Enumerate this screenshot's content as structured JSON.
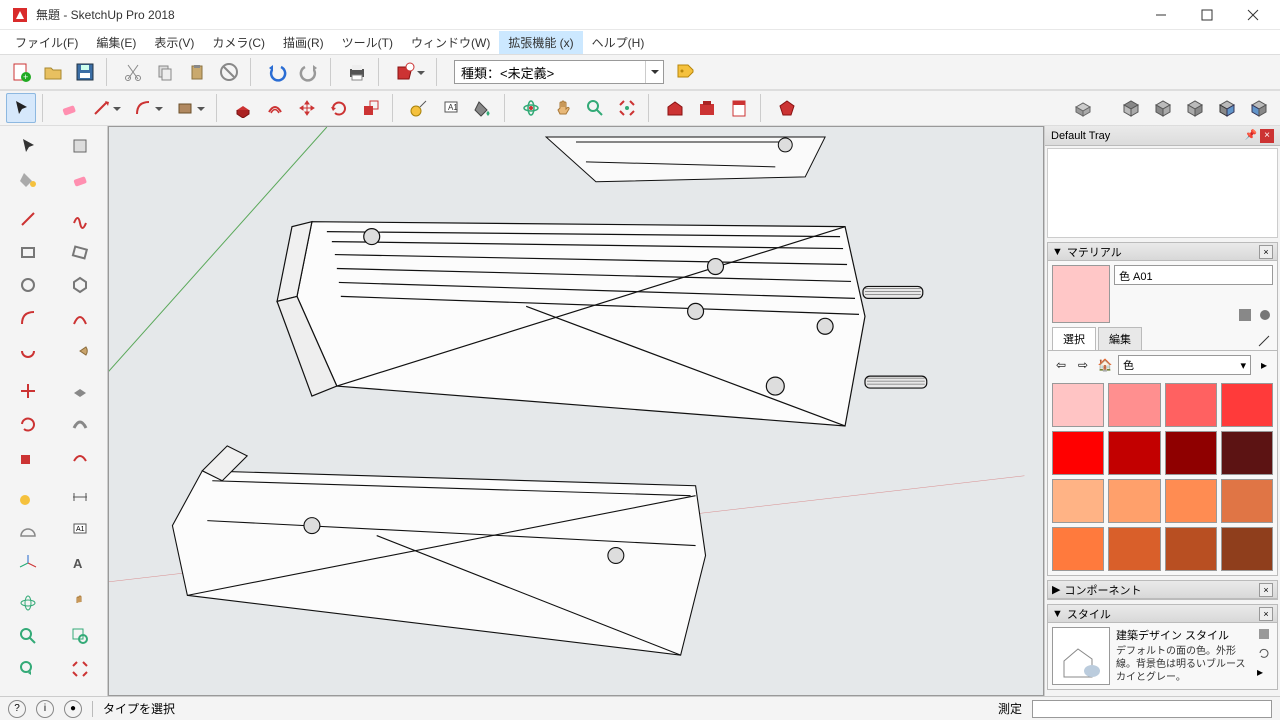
{
  "window": {
    "title": "無題 - SketchUp Pro 2018"
  },
  "menus": [
    "ファイル(F)",
    "編集(E)",
    "表示(V)",
    "カメラ(C)",
    "描画(R)",
    "ツール(T)",
    "ウィンドウ(W)",
    "拡張機能 (x)",
    "ヘルプ(H)"
  ],
  "menus_hover_index": 7,
  "category_label": "種類：<未定義>",
  "tray": {
    "title": "Default Tray"
  },
  "material_panel": {
    "title": "マテリアル",
    "name": "色 A01",
    "tab_select": "選択",
    "tab_edit": "編集",
    "category": "色"
  },
  "swatches": [
    "#ffc4c4",
    "#ff8f8f",
    "#ff6161",
    "#ff3a3a",
    "#ff0000",
    "#c20000",
    "#8f0000",
    "#5c1313",
    "#ffb385",
    "#ffa06b",
    "#ff8c52",
    "#e07545",
    "#ff7a3d",
    "#d95f2a",
    "#b84f22",
    "#8f3e1c"
  ],
  "components_panel": {
    "title": "コンポーネント"
  },
  "style_panel": {
    "title": "スタイル",
    "name": "建築デザイン スタイル",
    "desc": "デフォルトの面の色。外形線。背景色は明るいブルースカイとグレー。"
  },
  "status": {
    "hint": "タイプを選択",
    "measure_label": "測定"
  }
}
